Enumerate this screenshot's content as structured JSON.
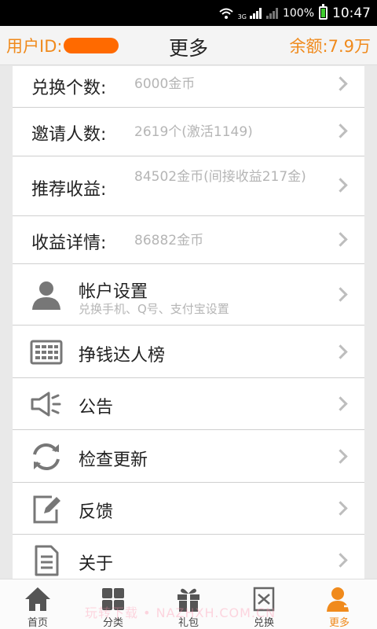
{
  "status_bar": {
    "network": "3G",
    "battery": "100%",
    "time": "10:47"
  },
  "header": {
    "user_id_label": "用户ID:",
    "title": "更多",
    "balance": "余额:7.9万"
  },
  "stats": [
    {
      "label": "兑换个数:",
      "value": "6000金币"
    },
    {
      "label": "邀请人数:",
      "value": "2619个(激活1149)"
    },
    {
      "label": "推荐收益:",
      "value": "84502金币(间接收益217金)"
    },
    {
      "label": "收益详情:",
      "value": "86882金币"
    }
  ],
  "menu": [
    {
      "label": "帐户设置",
      "sub": "兑换手机、Q号、支付宝设置",
      "icon": "person-icon"
    },
    {
      "label": "挣钱达人榜",
      "icon": "ranking-board-icon"
    },
    {
      "label": "公告",
      "icon": "megaphone-icon"
    },
    {
      "label": "检查更新",
      "icon": "refresh-icon"
    },
    {
      "label": "反馈",
      "icon": "feedback-edit-icon"
    },
    {
      "label": "关于",
      "icon": "document-icon"
    }
  ],
  "bottom_nav": [
    {
      "label": "首页",
      "icon": "home-icon"
    },
    {
      "label": "分类",
      "icon": "grid-icon"
    },
    {
      "label": "礼包",
      "icon": "gift-icon"
    },
    {
      "label": "兑换",
      "icon": "exchange-icon"
    },
    {
      "label": "更多",
      "icon": "user-more-icon",
      "active": true
    }
  ],
  "watermark": "玩转下载 • NAZHXH.COM.CN",
  "colors": {
    "accent": "#f08a1c",
    "uid_mask": "#ff6a00",
    "icon_gray": "#777777"
  }
}
